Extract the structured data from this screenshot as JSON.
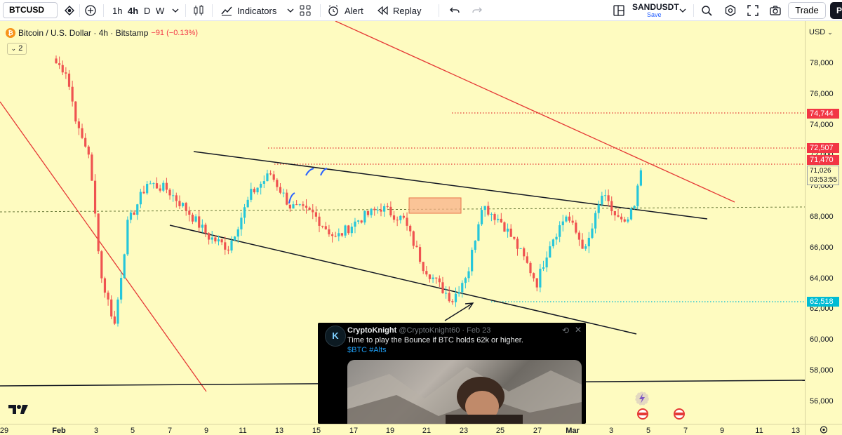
{
  "toolbar": {
    "symbol": "BTCUSD",
    "intervals": [
      "1h",
      "4h",
      "D",
      "W"
    ],
    "indicators_label": "Indicators",
    "alert_label": "Alert",
    "replay_label": "Replay",
    "layout_name": "SANDUSDT",
    "layout_save": "Save",
    "trade_label": "Trade",
    "avatar_letter": "P"
  },
  "legend": {
    "title": "Bitcoin / U.S. Dollar · 4h · Bitstamp",
    "change": "−91 (−0.13%)",
    "indicator_count": "2"
  },
  "price_axis": {
    "currency": "USD",
    "ticks": [
      "78,000",
      "76,000",
      "74,000",
      "72,000",
      "70,000",
      "68,000",
      "66,000",
      "64,000",
      "62,000",
      "60,000",
      "58,000",
      "56,000"
    ],
    "labels": [
      {
        "text": "74,744",
        "color": "#f23645"
      },
      {
        "text": "72,507",
        "color": "#f23645"
      },
      {
        "text": "71,470",
        "color": "#f23645"
      },
      {
        "text": "62,518",
        "color": "#00bcd4"
      }
    ],
    "last_price": "71,026",
    "countdown": "03:53:55"
  },
  "time_axis": {
    "ticks": [
      "29",
      "Feb",
      "3",
      "5",
      "7",
      "9",
      "11",
      "13",
      "15",
      "17",
      "19",
      "21",
      "23",
      "25",
      "27",
      "Mar",
      "3",
      "5",
      "7",
      "9",
      "11",
      "13"
    ]
  },
  "tweet": {
    "name": "CryptoKnight",
    "handle": "@CryptoKnight60 · Feb 23",
    "text": "Time to play the Bounce if BTC holds 62k or higher.",
    "tags": "$BTC #Alts"
  },
  "colors": {
    "chart_bg": "#fefbc0",
    "bull": "#26c6da",
    "bear": "#ef5350",
    "resistance_line": "#e53935"
  },
  "chart_data": {
    "type": "candlestick",
    "symbol": "BTCUSD",
    "interval": "4h",
    "ylim": [
      55000,
      80000
    ],
    "levels": [
      74744,
      72507,
      71470,
      62518
    ],
    "last": 71026,
    "path": [
      [
        0,
        78000
      ],
      [
        3,
        77500
      ],
      [
        7,
        73500
      ],
      [
        10,
        72200
      ],
      [
        14,
        64000
      ],
      [
        18,
        61000
      ],
      [
        22,
        67500
      ],
      [
        28,
        70200
      ],
      [
        34,
        69800
      ],
      [
        40,
        68500
      ],
      [
        47,
        66700
      ],
      [
        53,
        66000
      ],
      [
        60,
        69500
      ],
      [
        66,
        70800
      ],
      [
        72,
        68700
      ],
      [
        79,
        68200
      ],
      [
        86,
        66600
      ],
      [
        93,
        67800
      ],
      [
        100,
        68600
      ],
      [
        107,
        67800
      ],
      [
        113,
        64800
      ],
      [
        118,
        63500
      ],
      [
        122,
        62600
      ],
      [
        127,
        64600
      ],
      [
        131,
        68800
      ],
      [
        137,
        67700
      ],
      [
        141,
        66400
      ],
      [
        145,
        64900
      ],
      [
        148,
        63700
      ],
      [
        152,
        66300
      ],
      [
        157,
        68100
      ],
      [
        163,
        65800
      ],
      [
        168,
        69400
      ],
      [
        172,
        68100
      ],
      [
        175,
        67400
      ],
      [
        178,
        68600
      ],
      [
        180,
        71000
      ]
    ]
  }
}
